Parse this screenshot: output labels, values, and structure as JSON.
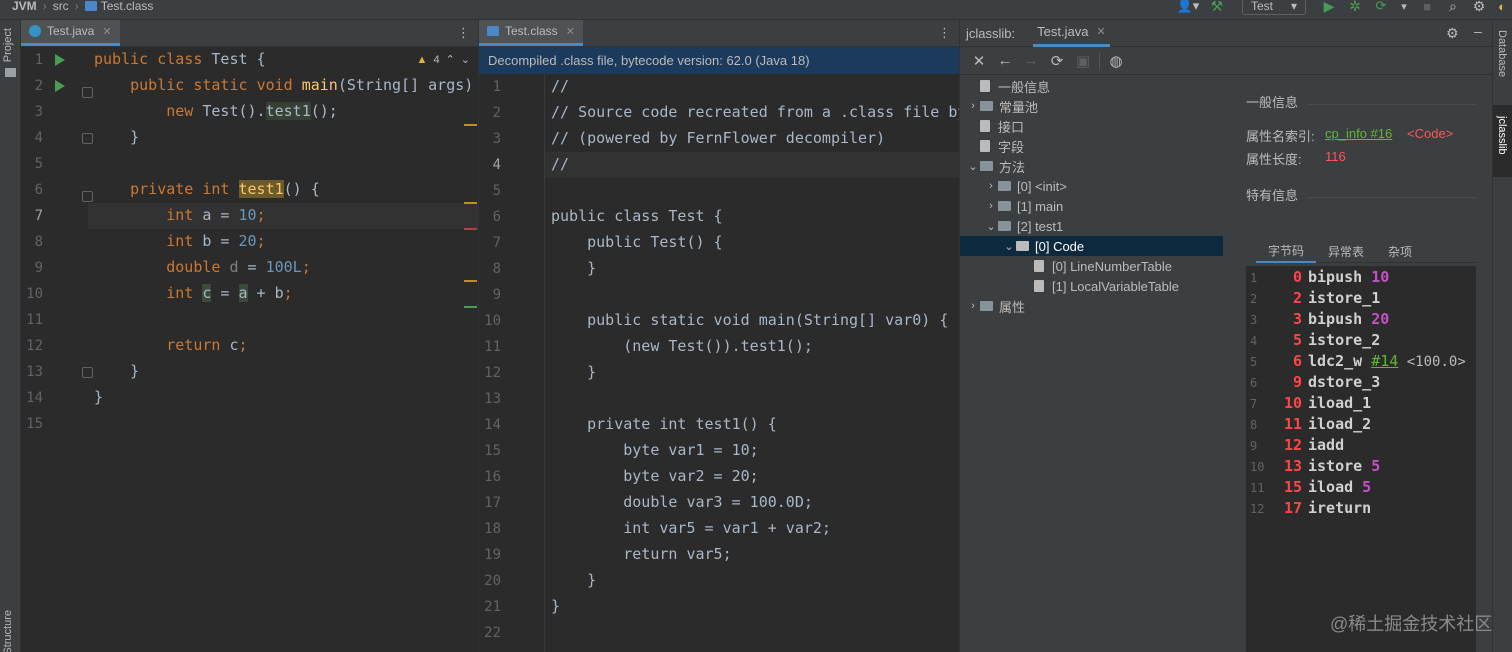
{
  "breadcrumb": {
    "project": "JVM",
    "folder": "src",
    "file": "Test.class"
  },
  "run_config": "Test",
  "left_stripe": {
    "project": "Project",
    "structure": "Structure"
  },
  "right_stripe": {
    "database": "Database",
    "jclasslib": "jclasslib"
  },
  "editor1": {
    "tab": "Test.java",
    "warnings": "4",
    "line_numbers": [
      "1",
      "2",
      "3",
      "4",
      "5",
      "6",
      "7",
      "8",
      "9",
      "10",
      "11",
      "12",
      "13",
      "14",
      "15"
    ]
  },
  "editor2": {
    "tab": "Test.class",
    "banner": "Decompiled .class file, bytecode version: 62.0 (Java 18)",
    "line_numbers": [
      "1",
      "2",
      "3",
      "4",
      "5",
      "6",
      "7",
      "8",
      "9",
      "10",
      "11",
      "12",
      "13",
      "14",
      "15",
      "16",
      "17",
      "18",
      "19",
      "20",
      "21",
      "22"
    ],
    "lines": [
      "//",
      "// Source code recreated from a .class file by",
      "// (powered by FernFlower decompiler)",
      "//",
      "",
      "public class Test {",
      "    public Test() {",
      "    }",
      "",
      "    public static void main(String[] var0) {",
      "        (new Test()).test1();",
      "    }",
      "",
      "    private int test1() {",
      "        byte var1 = 10;",
      "        byte var2 = 20;",
      "        double var3 = 100.0D;",
      "        int var5 = var1 + var2;",
      "        return var5;",
      "    }",
      "}",
      ""
    ]
  },
  "jclasslib": {
    "tab_label": "jclasslib:",
    "tab_file": "Test.java",
    "tree": [
      {
        "label": "一般信息",
        "kind": "file",
        "level": 0
      },
      {
        "label": "常量池",
        "kind": "folder",
        "level": 0,
        "arrow": "›"
      },
      {
        "label": "接口",
        "kind": "file",
        "level": 0
      },
      {
        "label": "字段",
        "kind": "file",
        "level": 0
      },
      {
        "label": "方法",
        "kind": "folder",
        "level": 0,
        "arrow": "⌄"
      },
      {
        "label": "[0] <init>",
        "kind": "folder",
        "level": 1,
        "arrow": "›"
      },
      {
        "label": "[1] main",
        "kind": "folder",
        "level": 1,
        "arrow": "›"
      },
      {
        "label": "[2] test1",
        "kind": "folder",
        "level": 1,
        "arrow": "⌄"
      },
      {
        "label": "[0] Code",
        "kind": "folder",
        "level": 2,
        "arrow": "⌄",
        "selected": true
      },
      {
        "label": "[0] LineNumberTable",
        "kind": "file",
        "level": 3
      },
      {
        "label": "[1] LocalVariableTable",
        "kind": "file",
        "level": 3
      },
      {
        "label": "属性",
        "kind": "folder",
        "level": 0,
        "arrow": "›"
      }
    ],
    "general_title": "一般信息",
    "attr_name_label": "属性名索引:",
    "attr_name_link": "cp_info #16",
    "attr_name_value": "<Code>",
    "attr_len_label": "属性长度:",
    "attr_len_value": "116",
    "specific_title": "特有信息",
    "subtabs": [
      "字节码",
      "异常表",
      "杂项"
    ],
    "bytecode": [
      {
        "n": "1",
        "off": "0",
        "op": "bipush",
        "arg": "10"
      },
      {
        "n": "2",
        "off": "2",
        "op": "istore_1",
        "arg": ""
      },
      {
        "n": "3",
        "off": "3",
        "op": "bipush",
        "arg": "20"
      },
      {
        "n": "4",
        "off": "5",
        "op": "istore_2",
        "arg": ""
      },
      {
        "n": "5",
        "off": "6",
        "op": "ldc2_w",
        "arg": "",
        "cp": "#14",
        "comment": "<100.0>"
      },
      {
        "n": "6",
        "off": "9",
        "op": "dstore_3",
        "arg": ""
      },
      {
        "n": "7",
        "off": "10",
        "op": "iload_1",
        "arg": ""
      },
      {
        "n": "8",
        "off": "11",
        "op": "iload_2",
        "arg": ""
      },
      {
        "n": "9",
        "off": "12",
        "op": "iadd",
        "arg": ""
      },
      {
        "n": "10",
        "off": "13",
        "op": "istore",
        "arg": "5"
      },
      {
        "n": "11",
        "off": "15",
        "op": "iload",
        "arg": "5"
      },
      {
        "n": "12",
        "off": "17",
        "op": "ireturn",
        "arg": ""
      }
    ]
  },
  "watermark": "@稀土掘金技术社区"
}
